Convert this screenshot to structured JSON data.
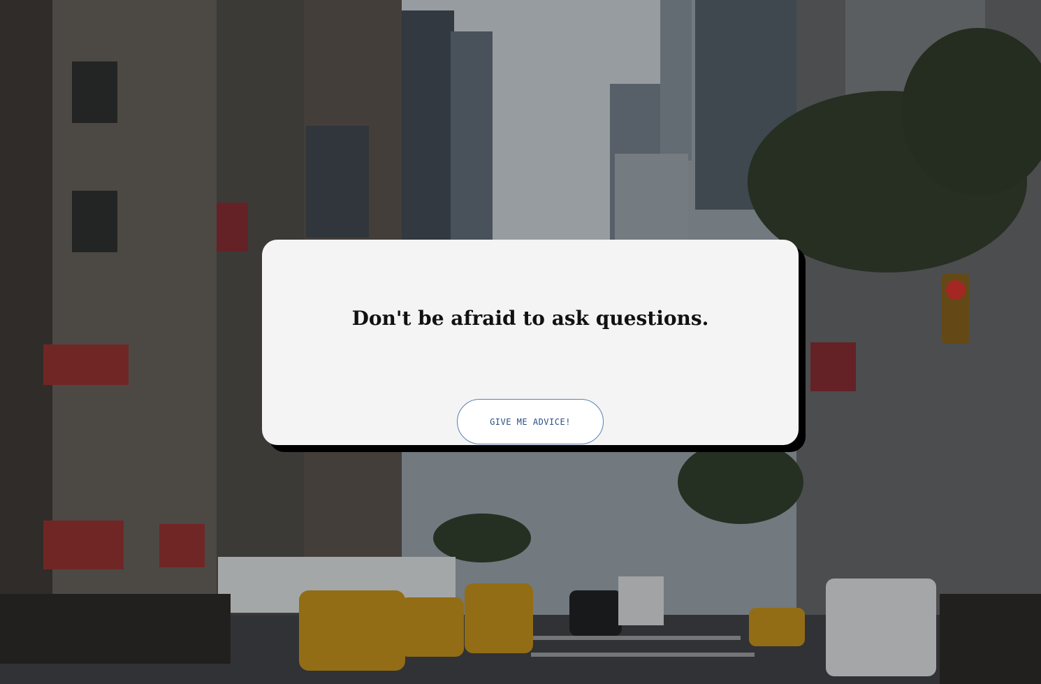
{
  "card": {
    "advice_text": "Don't be afraid to ask questions.",
    "button_label": "GIVE ME ADVICE!"
  },
  "colors": {
    "card_background": "#f4f4f4",
    "card_shadow": "#000000",
    "button_border": "#5b7fb8",
    "button_text": "#2a4e87"
  },
  "background": {
    "description_icon": "city-street-photo"
  }
}
